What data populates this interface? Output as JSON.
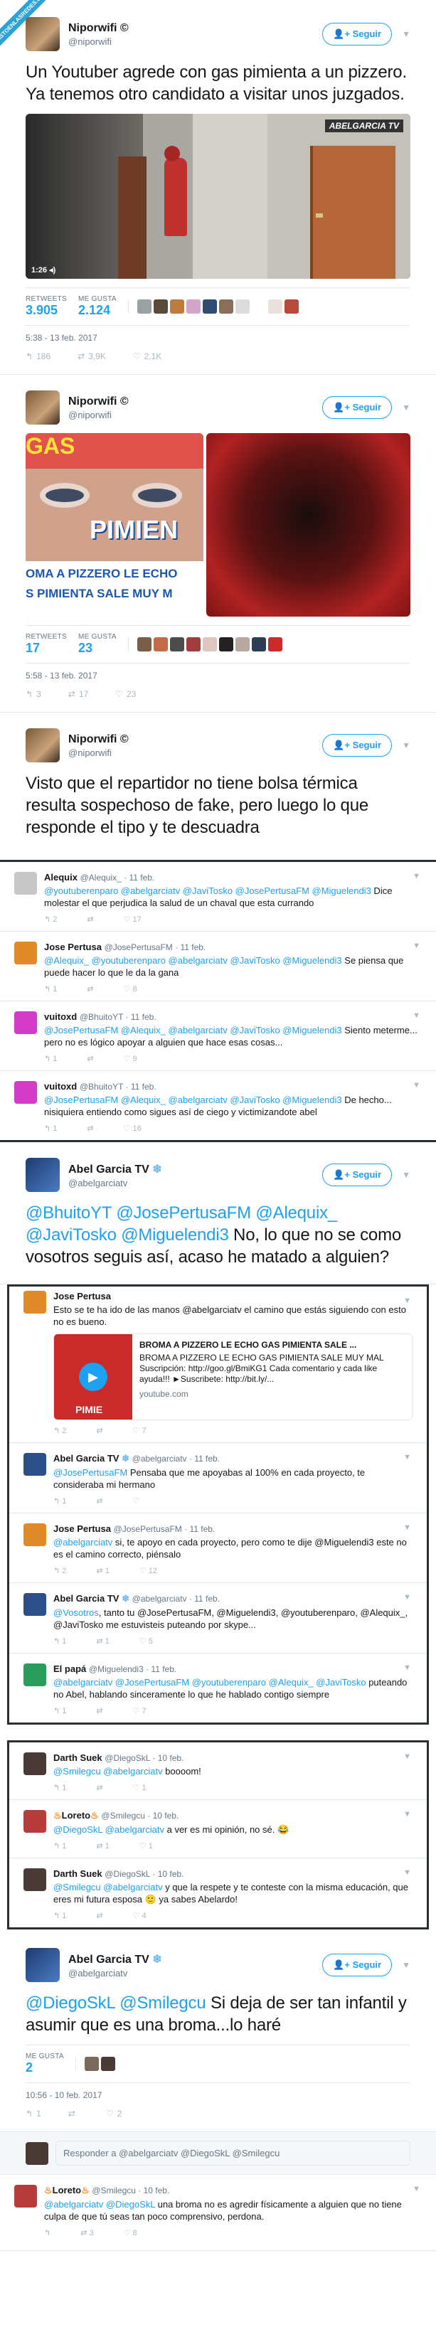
{
  "corner_badge": "VISTOENLASREDES.COM",
  "tweet1": {
    "name": "Niporwifi ©",
    "handle": "@niporwifi",
    "follow": "Seguir",
    "text": "Un Youtuber agrede con gas pimienta a un pizzero. Ya tenemos otro candidato a visitar unos juzgados.",
    "video_watermark": "ABELGARCIA TV",
    "video_time": "1:26",
    "retweets_label": "RETWEETS",
    "retweets": "3.905",
    "likes_label": "ME GUSTA",
    "likes": "2.124",
    "time": "5:38 - 13 feb. 2017",
    "replies_count": "186",
    "rt_count": "3,9K",
    "like_count": "2,1K"
  },
  "tweet2": {
    "name": "Niporwifi ©",
    "handle": "@niporwifi",
    "follow": "Seguir",
    "img_gas": "GAS",
    "img_pimienta": "PIMIEN",
    "img_caption1": "OMA A PIZZERO LE ECHO",
    "img_caption2": "S PIMIENTA SALE MUY M",
    "retweets_label": "RETWEETS",
    "retweets": "17",
    "likes_label": "ME GUSTA",
    "likes": "23",
    "time": "5:58 - 13 feb. 2017",
    "replies_count": "3",
    "rt_count": "17",
    "like_count": "23"
  },
  "tweet3": {
    "name": "Niporwifi ©",
    "handle": "@niporwifi",
    "follow": "Seguir",
    "text": "Visto que el repartidor no tiene bolsa térmica resulta sospechoso de fake, pero luego lo que responde el tipo y te descuadra"
  },
  "replies_a": [
    {
      "name": "Alequix",
      "meta": "@Alequix_ · 11 feb.",
      "mentions": "@youtuberenparo @abelgarciatv @JaviTosko @JosePertusaFM @Miguelendi3",
      "text": " Dice molestar el que perjudica la salud de un chaval que esta currando",
      "r": "2",
      "rt": "",
      "l": "17"
    },
    {
      "name": "Jose Pertusa",
      "meta": "@JosePertusaFM · 11 feb.",
      "mentions": "@Alequix_ @youtuberenparo @abelgarciatv @JaviTosko @Miguelendi3",
      "text": " Se piensa que puede hacer lo que le da la gana",
      "r": "1",
      "rt": "",
      "l": "8"
    },
    {
      "name": "vuitoxd",
      "meta": "@BhuitoYT · 11 feb.",
      "mentions": "@JosePertusaFM @Alequix_ @abelgarciatv @JaviTosko @Miguelendi3",
      "text": " Siento meterme... pero no es lógico apoyar a alguien que hace esas cosas...",
      "r": "1",
      "rt": "",
      "l": "9"
    },
    {
      "name": "vuitoxd",
      "meta": "@BhuitoYT · 11 feb.",
      "mentions": "@JosePertusaFM @Alequix_ @abelgarciatv @JaviTosko @Miguelendi3",
      "text": " De hecho... nisiquiera entiendo como sigues así de ciego y victimizandote abel",
      "r": "1",
      "rt": "",
      "l": "16"
    }
  ],
  "tweet4": {
    "name": "Abel Garcia TV",
    "handle": "@abelgarciatv",
    "follow": "Seguir",
    "mentions": "@BhuitoYT @JosePertusaFM @Alequix_ @JaviTosko @Miguelendi3",
    "text": " No, lo que no se como vosotros seguis así, acaso he matado a alguien?"
  },
  "replies_b": [
    {
      "name": "Jose Pertusa",
      "meta": "",
      "mentions": "",
      "text": "Esto se te ha ido de las manos @abelgarciatv el camino que estás siguiendo con esto no es bueno.",
      "r": "",
      "rt": "",
      "l": ""
    }
  ],
  "link_card": {
    "title": "BROMA A PIZZERO LE ECHO GAS PIMIENTA SALE ...",
    "desc": "BROMA A PIZZERO LE ECHO GAS PIMIENTA SALE MUY MAL Suscripción: http://goo.gl/BmiKG1 Cada comentario y cada like ayuda!!! ►Suscribete: http://bit.ly/...",
    "domain": "youtube.com",
    "thumb_text": "PIMIE",
    "r": "2",
    "rt": "",
    "l": "7"
  },
  "replies_c": [
    {
      "name": "Abel Garcia TV",
      "meta": "@abelgarciatv · 11 feb.",
      "mentions": "@JosePertusaFM",
      "text": " Pensaba que me apoyabas al 100% en cada proyecto, te consideraba mi hermano",
      "r": "1",
      "rt": "",
      "l": ""
    },
    {
      "name": "Jose Pertusa",
      "meta": "@JosePertusaFM · 11 feb.",
      "mentions": "@abelgarciatv",
      "text": " si, te apoyo en cada proyecto, pero como te dije @Miguelendi3 este no es el camino correcto, piénsalo",
      "r": "2",
      "rt": "1",
      "l": "12"
    },
    {
      "name": "Abel Garcia TV",
      "meta": "@abelgarciatv · 11 feb.",
      "mentions": "@Vosotros",
      "text": ", tanto tu @JosePertusaFM, @Miguelendi3, @youtuberenparo, @Alequix_, @JaviTosko me estuvisteis puteando por skype...",
      "r": "1",
      "rt": "1",
      "l": "5"
    },
    {
      "name": "El papá",
      "meta": "@Miguelendi3 · 11 feb.",
      "mentions": "@abelgarciatv @JosePertusaFM @youtuberenparo @Alequix_ @JaviTosko",
      "text": " puteando no Abel, hablando sinceramente lo que he hablado contigo siempre",
      "r": "1",
      "rt": "",
      "l": "7"
    }
  ],
  "replies_d": [
    {
      "name": "Darth Suek",
      "meta": "@DiegoSkL · 10 feb.",
      "mentions": "@Smilegcu @abelgarciatv",
      "text": " boooom!",
      "r": "1",
      "rt": "",
      "l": "1"
    },
    {
      "name": "Loreto",
      "meta": "@Smilegcu · 10 feb.",
      "mentions": "@DiegoSkL @abelgarciatv",
      "text": " a ver es mi opinión, no sé. 😂",
      "r": "1",
      "rt": "1",
      "l": "1"
    },
    {
      "name": "Darth Suek",
      "meta": "@DiegoSkL · 10 feb.",
      "mentions": "@Smilegcu @abelgarciatv",
      "text": " y que la respete y te conteste con la misma educación, que eres mi futura esposa 🙂 ya sabes Abelardo!",
      "r": "1",
      "rt": "",
      "l": "4"
    }
  ],
  "tweet5": {
    "name": "Abel Garcia TV",
    "handle": "@abelgarciatv",
    "follow": "Seguir",
    "mentions": "@DiegoSkL @Smilegcu",
    "text": " Si deja de ser tan infantil y asumir que es una broma...lo haré",
    "likes_label": "ME GUSTA",
    "likes": "2",
    "time": "10:56 - 10 feb. 2017",
    "replies_count": "1",
    "rt_count": "",
    "like_count": "2"
  },
  "reply_box_placeholder": "Responder a @abelgarciatv @DiegoSkL @Smilegcu",
  "replies_e": [
    {
      "name": "Loreto",
      "meta": "@Smilegcu · 10 feb.",
      "mentions": "@abelgarciatv @DiegoSkL",
      "text": " una broma no es agredir físicamente a alguien que no tiene culpa de que tú seas tan poco comprensivo, perdona.",
      "r": "",
      "rt": "3",
      "l": "8"
    }
  ]
}
